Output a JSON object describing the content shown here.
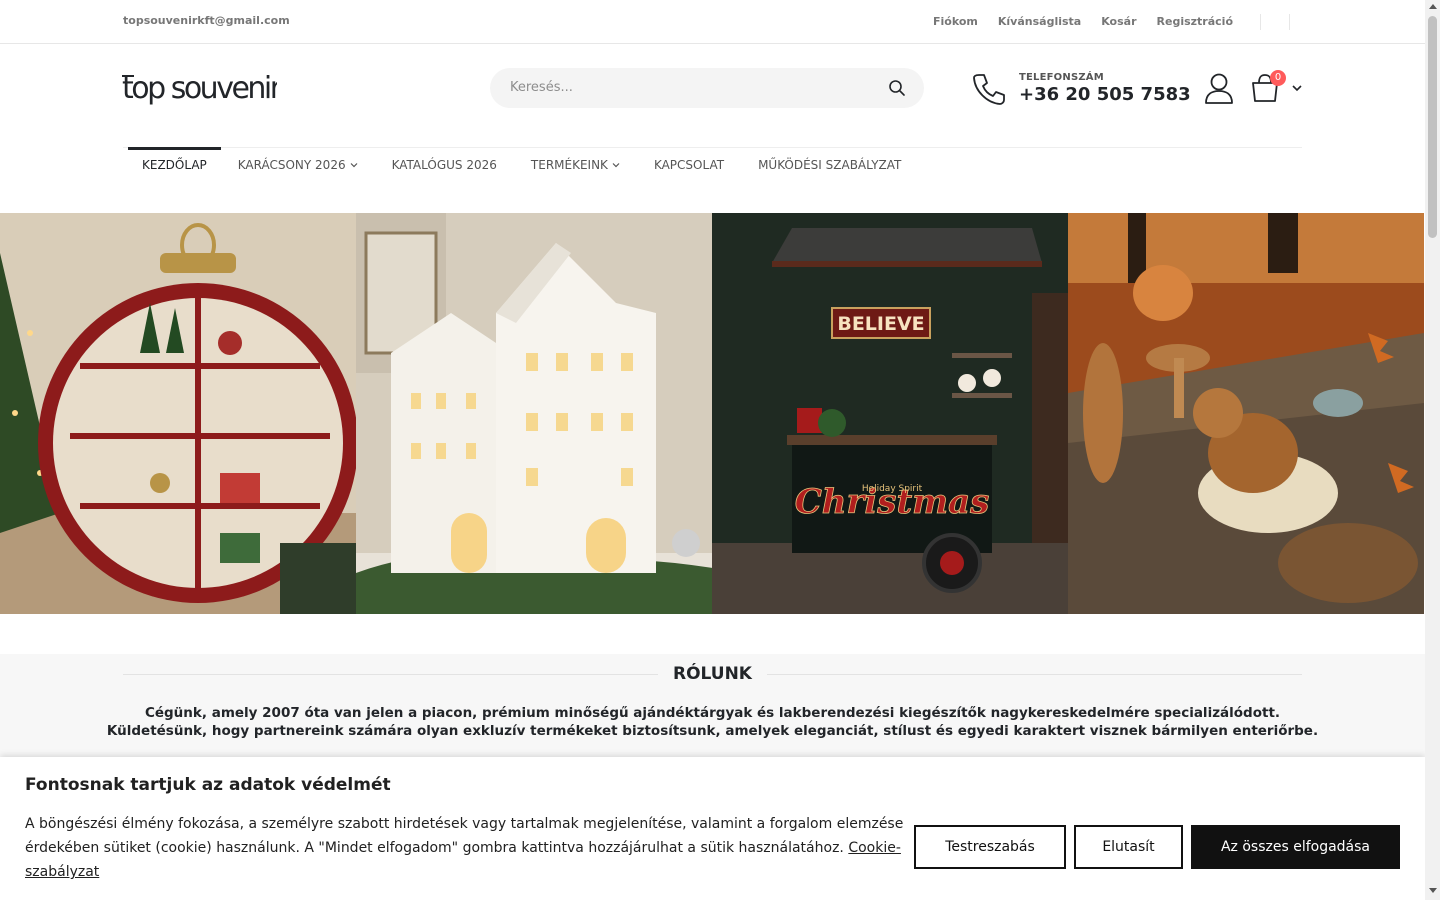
{
  "topbar": {
    "email": "topsouvenirkft@gmail.com",
    "links": [
      "Fiókom",
      "Kívánságlista",
      "Kosár",
      "Regisztráció"
    ]
  },
  "header": {
    "logo_text": "top souvenir",
    "search_placeholder": "Keresés...",
    "phone_label": "TELEFONSZÁM",
    "phone_number": "+36 20 505 7583",
    "cart_count": "0"
  },
  "nav": {
    "items": [
      {
        "label": "KEZDŐLAP",
        "active": true,
        "dropdown": false
      },
      {
        "label": "KARÁCSONY 2026",
        "active": false,
        "dropdown": true
      },
      {
        "label": "KATALÓGUS 2026",
        "active": false,
        "dropdown": false
      },
      {
        "label": "TERMÉKEINK",
        "active": false,
        "dropdown": true
      },
      {
        "label": "KAPCSOLAT",
        "active": false,
        "dropdown": false
      },
      {
        "label": "MŰKÖDÉSI SZABÁLYZAT",
        "active": false,
        "dropdown": false
      }
    ]
  },
  "banners": {
    "sign_believe": "BELIEVE",
    "sign_christmas": "Christmas",
    "sign_holiday": "Holiday Spirit"
  },
  "about": {
    "title": "RÓLUNK",
    "line1": "Cégünk, amely 2007 óta van jelen a piacon, prémium minőségű ajándéktárgyak és lakberendezési kiegészítők nagykereskedelmére specializálódott.",
    "line2": "Küldetésünk, hogy partnereink számára olyan exkluzív termékeket biztosítsunk, amelyek eleganciát, stílust és egyedi karaktert visznek bármilyen enteriőrbe."
  },
  "cookie": {
    "title": "Fontosnak tartjuk az adatok védelmét",
    "text": "A böngészési élmény fokozása, a személyre szabott hirdetések vagy tartalmak megjelenítése, valamint a forgalom elemzése érdekében sütiket (cookie) használunk. A \"Mindet elfogadom\" gombra kattintva hozzájárulhat a sütik használatához.",
    "policy_link": "Cookie-szabályzat",
    "btn_customize": "Testreszabás",
    "btn_reject": "Elutasít",
    "btn_accept": "Az összes elfogadása"
  },
  "colors": {
    "dark": "#222529",
    "badge": "#ff5b5b",
    "about_bg": "#f7f7f7"
  }
}
